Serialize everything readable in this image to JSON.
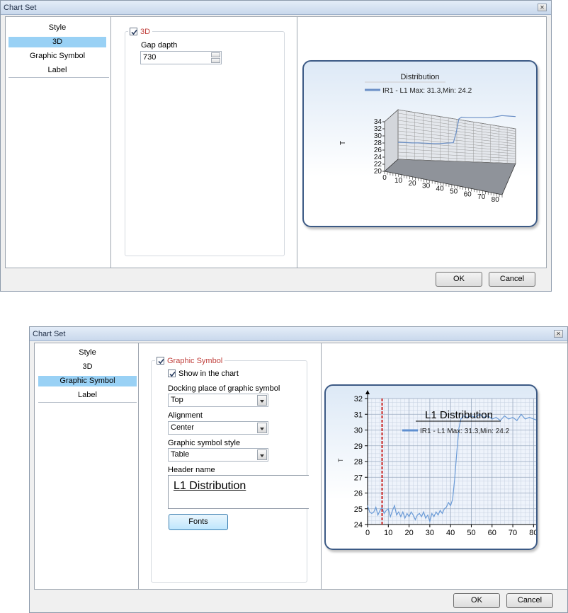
{
  "dialog1": {
    "title": "Chart Set",
    "nav": [
      "Style",
      "3D",
      "Graphic Symbol",
      "Label"
    ],
    "selected_nav": 1,
    "group_label": "3D",
    "group_checked": true,
    "gap_depth_label": "Gap dapth",
    "gap_depth_value": "730",
    "ok_label": "OK",
    "cancel_label": "Cancel",
    "chart_title": "Distribution",
    "legend_text": "IR1 - L1 Max: 31.3,Min: 24.2",
    "y_axis_label": "T",
    "y_ticks": [
      "34",
      "32",
      "30",
      "28",
      "26",
      "24",
      "22",
      "20"
    ],
    "x_ticks": [
      "0",
      "10",
      "20",
      "30",
      "40",
      "50",
      "60",
      "70",
      "80"
    ]
  },
  "dialog2": {
    "title": "Chart Set",
    "nav": [
      "Style",
      "3D",
      "Graphic Symbol",
      "Label"
    ],
    "selected_nav": 2,
    "group_label": "Graphic Symbol",
    "group_checked": true,
    "show_in_chart_label": "Show in the chart",
    "show_in_chart_checked": true,
    "docking_label": "Docking place of graphic symbol",
    "docking_value": "Top",
    "alignment_label": "Alignment",
    "alignment_value": "Center",
    "style_label": "Graphic symbol style",
    "style_value": "Table",
    "header_label": "Header name",
    "header_value": "L1  Distribution",
    "fonts_label": "Fonts",
    "ok_label": "OK",
    "cancel_label": "Cancel",
    "chart_title": "L1  Distribution",
    "legend_text": "IR1 - L1 Max: 31.3,Min: 24.2",
    "y_axis_label": "T",
    "y_ticks": [
      "32",
      "31",
      "30",
      "29",
      "28",
      "27",
      "26",
      "25",
      "24"
    ],
    "x_ticks": [
      "0",
      "10",
      "20",
      "30",
      "40",
      "50",
      "60",
      "70",
      "80"
    ]
  },
  "chart_data": [
    {
      "type": "line",
      "title": "Distribution",
      "series": [
        {
          "name": "IR1 - L1",
          "x": [
            0,
            5,
            10,
            15,
            20,
            25,
            30,
            35,
            40,
            42,
            44,
            46,
            50,
            55,
            60,
            65,
            70,
            75,
            80,
            85
          ],
          "values": [
            24.8,
            24.7,
            24.6,
            24.6,
            24.5,
            24.4,
            24.4,
            24.5,
            24.6,
            27.0,
            30.4,
            30.8,
            30.6,
            30.5,
            30.4,
            30.3,
            30.4,
            30.6,
            30.4,
            30.2
          ],
          "color": "#6a8fc6"
        }
      ],
      "xlim": [
        0,
        85
      ],
      "ylim": [
        20,
        34
      ],
      "ylabel": "T",
      "grid": true,
      "legend": "top"
    },
    {
      "type": "line",
      "title": "L1  Distribution",
      "series": [
        {
          "name": "IR1 - L1",
          "x": [
            0,
            1,
            2,
            3,
            4,
            5,
            6,
            7,
            8,
            9,
            10,
            11,
            12,
            13,
            14,
            15,
            16,
            17,
            18,
            19,
            20,
            21,
            22,
            23,
            24,
            25,
            26,
            27,
            28,
            29,
            30,
            31,
            32,
            33,
            34,
            35,
            36,
            37,
            38,
            39,
            40,
            41,
            42,
            43,
            44,
            45,
            46,
            48,
            50,
            52,
            54,
            56,
            58,
            60,
            62,
            64,
            66,
            68,
            70,
            72,
            74,
            76,
            78,
            80,
            82,
            84,
            85
          ],
          "values": [
            25.2,
            24.8,
            24.7,
            24.8,
            25.1,
            24.6,
            24.9,
            25.1,
            24.7,
            24.9,
            25.0,
            24.5,
            24.9,
            25.2,
            24.6,
            24.8,
            24.5,
            24.8,
            24.4,
            24.7,
            24.5,
            24.8,
            24.6,
            24.3,
            24.6,
            24.7,
            24.5,
            24.8,
            24.4,
            24.6,
            24.2,
            24.7,
            24.5,
            24.8,
            24.6,
            24.9,
            24.7,
            25.0,
            25.1,
            25.4,
            25.2,
            25.6,
            26.9,
            28.6,
            30.1,
            30.7,
            30.9,
            30.8,
            30.9,
            30.8,
            31.0,
            30.8,
            30.9,
            30.7,
            30.8,
            30.6,
            30.9,
            30.7,
            30.8,
            30.6,
            31.0,
            30.7,
            30.8,
            30.7,
            30.6,
            30.3,
            30.2
          ],
          "color": "#6a9ad6"
        }
      ],
      "xlim": [
        0,
        85
      ],
      "ylim": [
        24,
        32
      ],
      "ylabel": "T",
      "marker_line_x": 7,
      "marker_line_color": "#c8201e",
      "grid": true,
      "legend": "top"
    }
  ]
}
